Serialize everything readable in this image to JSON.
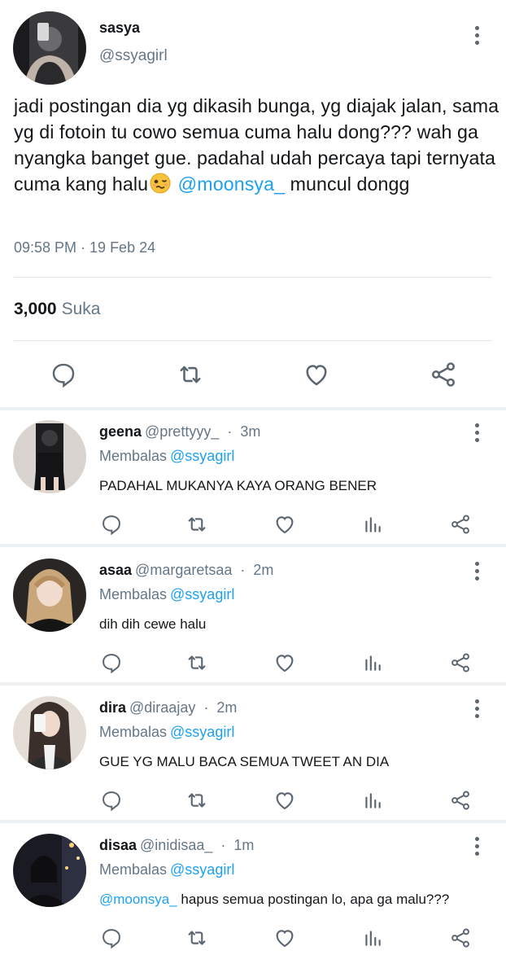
{
  "main_tweet": {
    "name": "sasya",
    "handle": "@ssyagirl",
    "text_part1": "jadi postingan dia yg dikasih bunga, yg diajak jalan, sama yg di fotoin tu cowo semua cuma halu dong??? wah ga nyangka banget gue. padahal udah percaya tapi ternyata cuma kang halu",
    "text_mention": "@moonsya_",
    "text_part2": " muncul dongg",
    "timestamp": "09:58 PM · 19 Feb 24",
    "likes_count": "3,000",
    "likes_label": "Suka",
    "actions": [
      "reply-icon",
      "retweet-icon",
      "like-icon",
      "share-icon"
    ]
  },
  "replies": [
    {
      "name": "geena",
      "handle": "@prettyyy_",
      "dot": "·",
      "time": "3m",
      "replying_label": "Membalas",
      "replying_to": "@ssyagirl",
      "text": "PADAHAL MUKANYA KAYA ORANG BENER",
      "mention": "",
      "avatar_color": "#2b2b2b"
    },
    {
      "name": "asaa",
      "handle": "@margaretsaa",
      "dot": "·",
      "time": "2m",
      "replying_label": "Membalas",
      "replying_to": "@ssyagirl",
      "text": "dih dih cewe halu",
      "mention": "",
      "avatar_color": "#3a2e2a"
    },
    {
      "name": "dira",
      "handle": "@diraajay",
      "dot": "·",
      "time": "2m",
      "replying_label": "Membalas",
      "replying_to": "@ssyagirl",
      "text": "GUE YG MALU BACA SEMUA TWEET AN DIA",
      "mention": "",
      "avatar_color": "#cfc6bd"
    },
    {
      "name": "disaa",
      "handle": "@inidisaa_",
      "dot": "·",
      "time": "1m",
      "replying_label": "Membalas",
      "replying_to": "@ssyagirl",
      "text": "hapus semua postingan lo, apa ga malu???",
      "mention": "@moonsya_",
      "avatar_color": "#1c1c22"
    }
  ],
  "colors": {
    "accent": "#1da1f2",
    "secondary_text": "#657786",
    "icon": "#5b6670",
    "divider": "#e1e8ed"
  }
}
